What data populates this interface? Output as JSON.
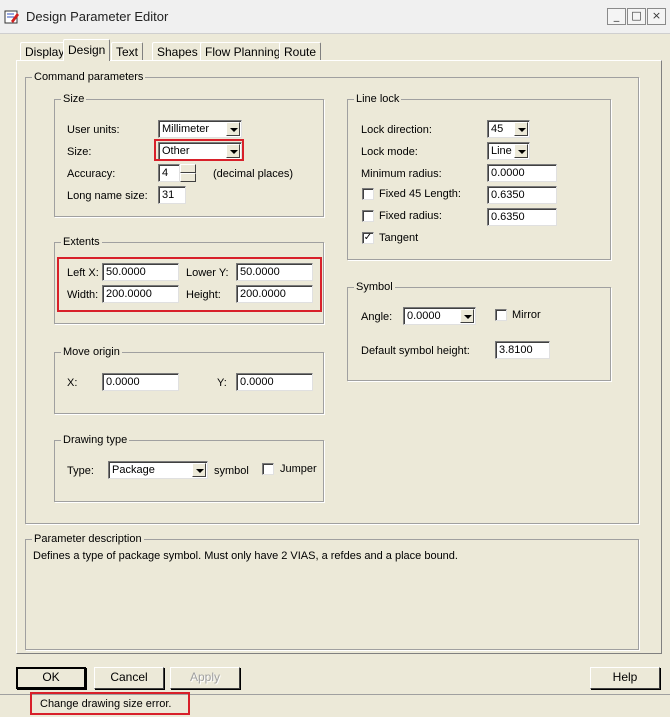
{
  "window": {
    "title": "Design Parameter Editor",
    "minimize_glyph": "_",
    "maximize_glyph": "□",
    "close_glyph": "×"
  },
  "tabs": [
    "Display",
    "Design",
    "Text",
    "Shapes",
    "Flow Planning",
    "Route"
  ],
  "command_parameters": {
    "title": "Command parameters"
  },
  "size_group": {
    "title": "Size",
    "user_units_label": "User units:",
    "user_units_value": "Millimeter",
    "size_label": "Size:",
    "size_value": "Other",
    "accuracy_label": "Accuracy:",
    "accuracy_value": "4",
    "decimal_places": "(decimal places)",
    "long_name_label": "Long name size:",
    "long_name_value": "31"
  },
  "extents": {
    "title": "Extents",
    "left_x_label": "Left X:",
    "left_x_value": "50.0000",
    "lower_y_label": "Lower Y:",
    "lower_y_value": "50.0000",
    "width_label": "Width:",
    "width_value": "200.0000",
    "height_label": "Height:",
    "height_value": "200.0000"
  },
  "move_origin": {
    "title": "Move origin",
    "x_label": "X:",
    "x_value": "0.0000",
    "y_label": "Y:",
    "y_value": "0.0000"
  },
  "drawing_type": {
    "title": "Drawing type",
    "type_label": "Type:",
    "type_value": "Package",
    "symbol_label": "symbol",
    "jumper_label": "Jumper"
  },
  "line_lock": {
    "title": "Line lock",
    "lock_direction_label": "Lock direction:",
    "lock_direction_value": "45",
    "lock_mode_label": "Lock mode:",
    "lock_mode_value": "Line",
    "min_radius_label": "Minimum radius:",
    "min_radius_value": "0.0000",
    "fixed45_label": "Fixed 45 Length:",
    "fixed45_value": "0.6350",
    "fixed_radius_label": "Fixed radius:",
    "fixed_radius_value": "0.6350",
    "tangent_label": "Tangent",
    "check_glyph": "✓"
  },
  "symbol": {
    "title": "Symbol",
    "angle_label": "Angle:",
    "angle_value": "0.0000",
    "mirror_label": "Mirror",
    "default_height_label": "Default symbol height:",
    "default_height_value": "3.8100"
  },
  "parameter_description": {
    "title": "Parameter description",
    "text": "Defines a type of package symbol.  Must only have 2 VIAS, a refdes and a place bound."
  },
  "buttons": {
    "ok": "OK",
    "cancel": "Cancel",
    "apply": "Apply",
    "help": "Help"
  },
  "status": {
    "message": "Change drawing size error."
  },
  "colors": {
    "highlight": "#d8202a",
    "dialog_bg": "#ece9d8"
  }
}
